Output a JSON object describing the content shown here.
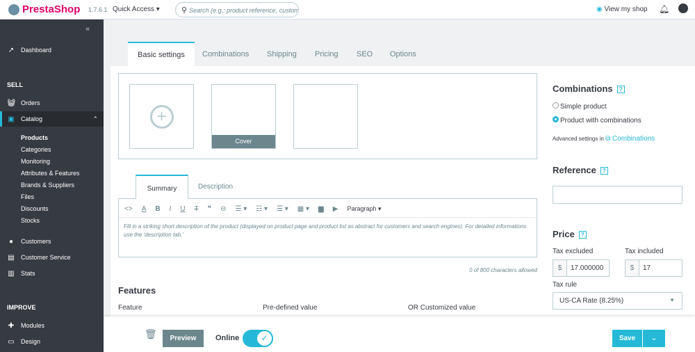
{
  "header": {
    "brand": "PrestaShop",
    "version": "1.7.6.1",
    "quick_access": "Quick Access",
    "search_placeholder": "Search (e.g.: product reference, customer name…)",
    "view_shop": "View my shop"
  },
  "sidebar": {
    "dashboard": "Dashboard",
    "sell": "SELL",
    "orders": "Orders",
    "catalog": "Catalog",
    "catalog_sub": [
      "Products",
      "Categories",
      "Monitoring",
      "Attributes & Features",
      "Brands & Suppliers",
      "Files",
      "Discounts",
      "Stocks"
    ],
    "customers": "Customers",
    "customer_service": "Customer Service",
    "stats": "Stats",
    "improve": "IMPROVE",
    "modules": "Modules",
    "design": "Design"
  },
  "tabs": [
    "Basic settings",
    "Combinations",
    "Shipping",
    "Pricing",
    "SEO",
    "Options"
  ],
  "images": {
    "cover": "Cover"
  },
  "editor": {
    "tabs": [
      "Summary",
      "Description"
    ],
    "paragraph": "Paragraph",
    "placeholder": "Fill in a striking short description of the product (displayed on product page and product list as abstract for customers and search engines). For detailed informations use the 'description tab.'",
    "counter": "0 of 800 characters allowed"
  },
  "features": {
    "title": "Features",
    "cols": [
      "Feature",
      "Pre-defined value",
      "OR Customized value"
    ]
  },
  "right": {
    "combinations_title": "Combinations",
    "simple": "Simple product",
    "with_comb": "Product with combinations",
    "adv": "Advanced settings in",
    "adv_link": "Combinations",
    "reference_title": "Reference",
    "reference_value": "",
    "price_title": "Price",
    "tax_excl": "Tax excluded",
    "tax_incl": "Tax included",
    "currency": "$",
    "price_excl": "17.000000",
    "price_incl": "17",
    "tax_rule": "Tax rule",
    "tax_rule_value": "US-CA Rate (8.25%)"
  },
  "footer": {
    "preview": "Preview",
    "online": "Online",
    "save": "Save"
  }
}
